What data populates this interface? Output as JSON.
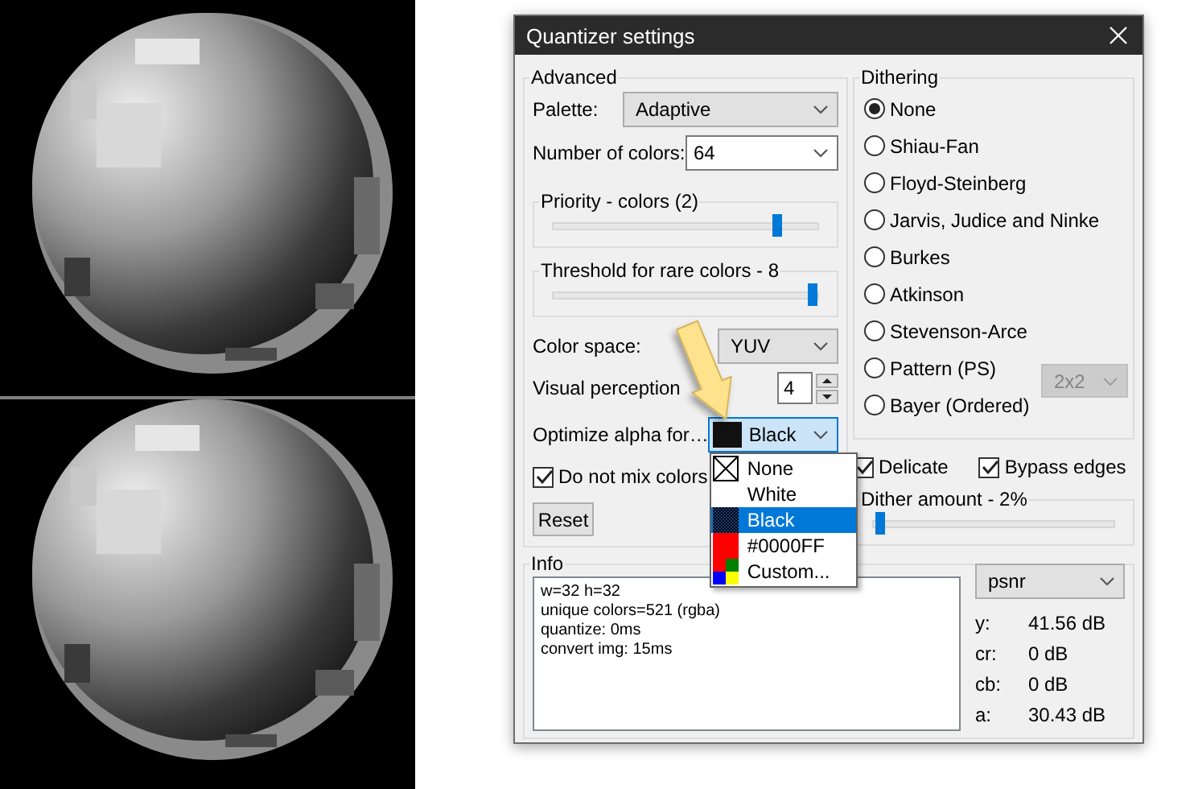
{
  "window": {
    "title": "Quantizer settings"
  },
  "advanced": {
    "title": "Advanced",
    "palette": {
      "label": "Palette:",
      "value": "Adaptive"
    },
    "colors": {
      "label": "Number of colors:",
      "value": "64"
    },
    "priority": {
      "title": "Priority - colors (2)",
      "level": 0.85
    },
    "threshold": {
      "title": "Threshold for rare colors - 8",
      "level": 0.98
    },
    "color_space": {
      "label": "Color space:",
      "value": "YUV"
    },
    "visual": {
      "label": "Visual perception",
      "value": "4"
    },
    "optimize": {
      "label": "Optimize alpha for…",
      "value": "Black",
      "open": true
    },
    "no_mix": {
      "label": "Do not mix colors",
      "checked": true
    },
    "reset": "Reset"
  },
  "alpha_options": [
    {
      "label": "None",
      "kind": "none",
      "selected": false
    },
    {
      "label": "White",
      "kind": "white",
      "selected": false
    },
    {
      "label": "Black",
      "kind": "black",
      "selected": true
    },
    {
      "label": "#0000FF",
      "kind": "red",
      "selected": false
    },
    {
      "label": "Custom...",
      "kind": "custom",
      "selected": false
    }
  ],
  "dithering": {
    "title": "Dithering",
    "options": [
      {
        "label": "None",
        "selected": true
      },
      {
        "label": "Shiau-Fan",
        "selected": false
      },
      {
        "label": "Floyd-Steinberg",
        "selected": false
      },
      {
        "label": "Jarvis, Judice and Ninke",
        "selected": false
      },
      {
        "label": "Burkes",
        "selected": false
      },
      {
        "label": "Atkinson",
        "selected": false
      },
      {
        "label": "Stevenson-Arce",
        "selected": false
      },
      {
        "label": "Pattern (PS)",
        "selected": false
      },
      {
        "label": "Bayer (Ordered)",
        "selected": false
      }
    ],
    "pattern_size": {
      "value": "2x2",
      "disabled": true
    }
  },
  "delicate": {
    "label": "Delicate",
    "checked": true
  },
  "bypass": {
    "label": "Bypass edges",
    "checked": true
  },
  "dither_amount": {
    "title": "Dither amount - 2%",
    "level": 0.03
  },
  "info": {
    "title": "Info",
    "lines": [
      "w=32 h=32",
      "unique colors=521 (rgba)",
      "quantize: 0ms",
      "convert img: 15ms"
    ],
    "metric": "psnr",
    "stats": [
      {
        "label": "y:",
        "value": "41.56 dB"
      },
      {
        "label": "cr:",
        "value": "0 dB"
      },
      {
        "label": "cb:",
        "value": "0 dB"
      },
      {
        "label": "a:",
        "value": "30.43 dB"
      }
    ]
  }
}
